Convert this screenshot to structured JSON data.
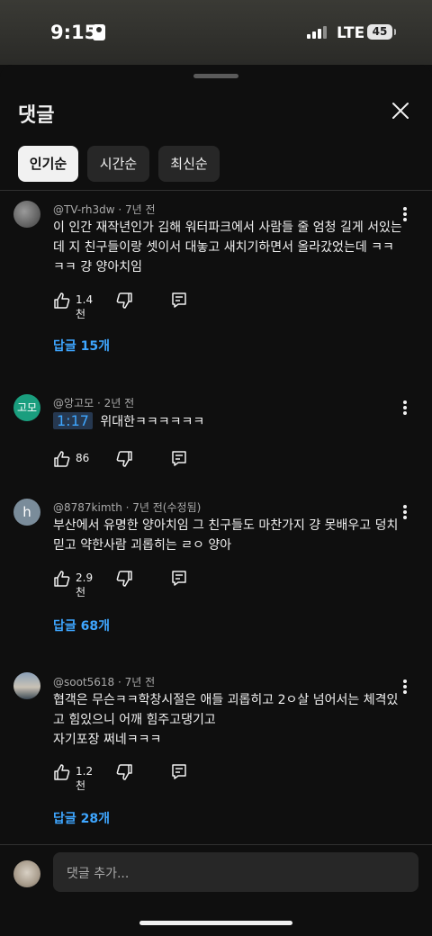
{
  "status_bar": {
    "time": "9:15",
    "network": "LTE",
    "battery": "45"
  },
  "sheet": {
    "title": "댓글",
    "sort_chips": [
      {
        "label": "인기순",
        "active": true
      },
      {
        "label": "시간순",
        "active": false
      },
      {
        "label": "최신순",
        "active": false
      }
    ]
  },
  "comments": [
    {
      "author": "@TV-rh3dw",
      "age": "7년 전",
      "text": "이 인간 재작년인가 김해 워터파크에서 사람들 줄 엄청 길게 서있는데 지 친구들이랑 셋이서 대놓고 새치기하면서 올라갔었는데 ㅋㅋㅋㅋ 걍 양아치임",
      "likes": "1.4천",
      "replies": "답글 15개"
    },
    {
      "author": "@앙고모",
      "age": "2년 전",
      "avatar_text": "고모",
      "timestamp": "1:17",
      "text": "위대한ㅋㅋㅋㅋㅋㅋ",
      "likes": "86"
    },
    {
      "author": "@8787kimth",
      "age": "7년 전(수정됨)",
      "avatar_text": "h",
      "text": "부산에서 유명한 양아치임 그 친구들도 마찬가지 걍 못배우고 덩치믿고 약한사람 괴롭히는 ㄹㅇ 양아",
      "likes": "2.9천",
      "replies": "답글 68개"
    },
    {
      "author": "@soot5618",
      "age": "7년 전",
      "text": "협객은 무슨ㅋㅋ학창시절은 애들 괴롭히고 2ㅇ살 넘어서는 체격있고 힘있으니 어깨 힘주고댕기고\n자기포장 쩌네ㅋㅋㅋ",
      "likes": "1.2천",
      "replies": "답글 28개"
    }
  ],
  "composer": {
    "placeholder": "댓글 추가..."
  },
  "colors": {
    "background": "#0f0f0f",
    "link": "#3ea6ff",
    "chip_active": "#f1f1f1",
    "chip_inactive": "#272727"
  }
}
